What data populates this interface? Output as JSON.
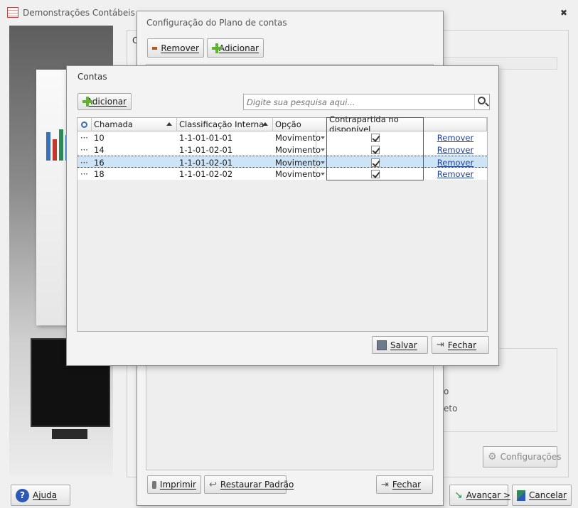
{
  "main_window": {
    "title": "Demonstrações Contábeis",
    "close_label": "✖",
    "ghost_texts": [
      "o",
      "eto"
    ],
    "help_label": "Ajuda",
    "settings_label": "Configurações",
    "next_label": "Avançar >",
    "cancel_label": "Cancelar",
    "peek_letter": "C"
  },
  "plano": {
    "title": "Configuração do Plano de contas",
    "remove_label": "Remover",
    "add_label": "Adicionar",
    "print_label": "Imprimir",
    "restore_label": "Restaurar Padrão",
    "close_label": "Fechar"
  },
  "contas": {
    "title": "Contas",
    "add_label": "Adicionar",
    "search_placeholder": "Digite sua pesquisa aqui...",
    "columns": [
      "Chamada",
      "Classificação Interna",
      "Opção",
      "Contrapartida no disponível",
      ""
    ],
    "row_indicator": "···",
    "rows": [
      {
        "chamada": "10",
        "classificacao": "1-1-01-01-01",
        "opcao": "Movimento",
        "contrapartida": true,
        "acao": "Remover"
      },
      {
        "chamada": "14",
        "classificacao": "1-1-01-02-01",
        "opcao": "Movimento",
        "contrapartida": true,
        "acao": "Remover"
      },
      {
        "chamada": "16",
        "classificacao": "1-1-01-02-01",
        "opcao": "Movimento",
        "contrapartida": true,
        "acao": "Remover"
      },
      {
        "chamada": "18",
        "classificacao": "1-1-01-02-02",
        "opcao": "Movimento",
        "contrapartida": true,
        "acao": "Remover"
      }
    ],
    "selected_row": 2,
    "save_label": "Salvar",
    "close_label": "Fechar"
  },
  "colors": {
    "highlight_border": "#d9232b",
    "selected_row": "#cde4f7",
    "link": "#1f3f9c",
    "plus_green": "#5fb32d"
  }
}
